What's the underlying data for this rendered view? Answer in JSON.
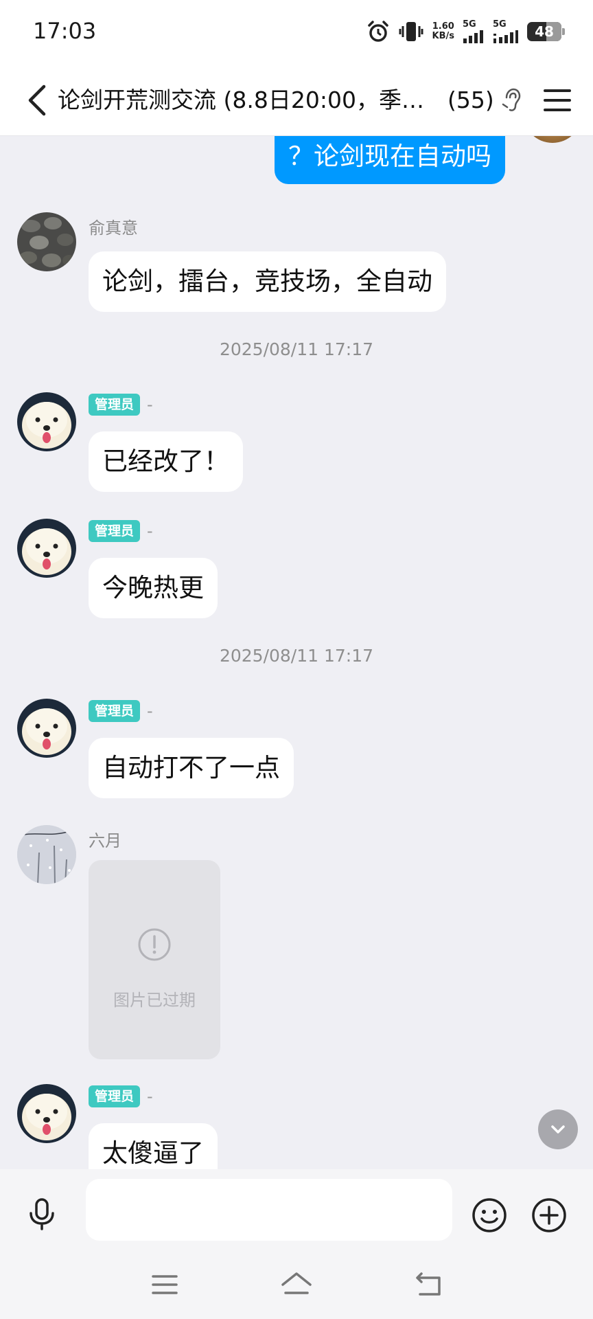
{
  "status_bar": {
    "time": "17:03",
    "net_speed_value": "1.60",
    "net_speed_unit": "KB/s",
    "sim1_label": "5G",
    "sim2_label": "5G",
    "battery": "48",
    "battery_level_percent": 48
  },
  "header": {
    "title": "论剑开荒测交流 (8.8日20:00，季…",
    "member_count": "(55)"
  },
  "messages": [
    {
      "type": "outgoing",
      "text": "？论剑现在自动吗"
    },
    {
      "type": "incoming",
      "sender": "俞真意",
      "text": "论剑，擂台，竞技场，全自动"
    },
    {
      "type": "timestamp",
      "text": "2025/08/11 17:17"
    },
    {
      "type": "incoming",
      "badge": "管理员",
      "sender": "-",
      "text": "已经改了！"
    },
    {
      "type": "incoming",
      "badge": "管理员",
      "sender": "-",
      "text": "今晚热更"
    },
    {
      "type": "timestamp",
      "text": "2025/08/11 17:17"
    },
    {
      "type": "incoming",
      "badge": "管理员",
      "sender": "-",
      "text": "自动打不了一点"
    },
    {
      "type": "incoming_image",
      "sender": "六月",
      "image_status": "图片已过期"
    },
    {
      "type": "incoming",
      "badge": "管理员",
      "sender": "-",
      "text": "太傻逼了"
    }
  ],
  "input": {
    "value": "",
    "placeholder": ""
  },
  "icons": {
    "back": "back-icon",
    "ear": "ear-icon",
    "menu": "menu-icon",
    "mic": "microphone-icon",
    "emoji": "emoji-icon",
    "plus": "plus-icon",
    "scroll_down": "chevron-down-icon",
    "expired": "exclamation-circle-icon"
  },
  "colors": {
    "outgoing_bubble": "#0099ff",
    "admin_badge": "#3ec9c1",
    "chat_background": "#efeff4"
  }
}
